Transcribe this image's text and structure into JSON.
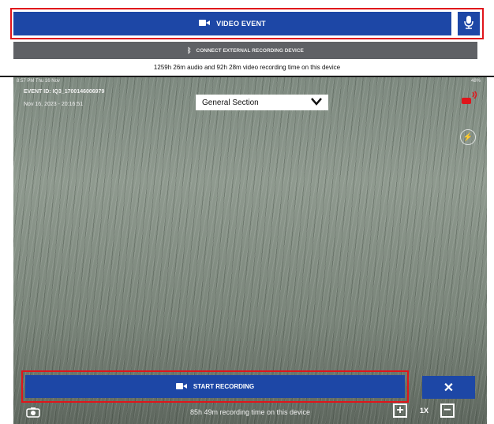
{
  "header": {
    "video_event_label": "VIDEO EVENT",
    "connect_label": "CONNECT EXTERNAL RECORDING DEVICE",
    "recording_time_text": "1259h 26m audio and 92h 28m video recording time on this device"
  },
  "camera": {
    "status_left": "8:57 PM  Thu 16 Nov",
    "status_right": "48%",
    "event_id": "EVENT ID: IQ3_1700146006979",
    "event_date": "Nov 16, 2023 - 20:16:51",
    "section": "General Section",
    "start_label": "START RECORDING",
    "close_label": "✕",
    "bottom_time": "85h 49m recording time on this device",
    "zoom_in": "+",
    "zoom_level": "1X",
    "zoom_out": "−"
  },
  "colors": {
    "primary_blue": "#1d47a6",
    "highlight_red": "#e0151b",
    "connect_gray": "#5f6165"
  },
  "icons": [
    "video-camera-icon",
    "microphone-icon",
    "bluetooth-icon",
    "chevron-down-icon",
    "recording-indicator-icon",
    "flash-off-icon",
    "switch-camera-icon"
  ]
}
